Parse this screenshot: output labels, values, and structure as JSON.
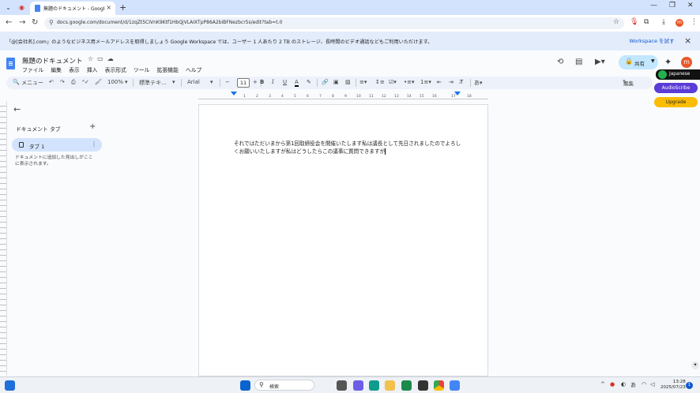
{
  "browser": {
    "tab_title": "無題のドキュメント - Google ドキュ",
    "url": "docs.google.com/document/d/1zqZt5CIVnK9Ktf1HbQjVLAIXTpP86A2biBFNezbcr5s/edit?tab=t.0"
  },
  "banner": {
    "message": "「@[会社名].com」のようなビジネス用メールアドレスを取得しましょう Google Workspace では、ユーザー 1 人あたり 2 TB のストレージ、長時間のビデオ通話などもご利用いただけます。",
    "try_label": "Workspace を試す"
  },
  "doc": {
    "title": "無題のドキュメント",
    "menu": [
      "ファイル",
      "編集",
      "表示",
      "挿入",
      "表示形式",
      "ツール",
      "拡張機能",
      "ヘルプ"
    ],
    "share_label": "共有",
    "avatar_letter": "m"
  },
  "format_toolbar": {
    "menus_label": "メニュー",
    "zoom": "100%",
    "style": "標準テキ...",
    "font": "Arial",
    "font_size": "11",
    "edit_mode": "編集"
  },
  "extensions": {
    "japanese": "Japanese",
    "audioscribe": "AudioScribe",
    "upgrade": "Upgrade"
  },
  "ruler_ticks": [
    "1",
    "2",
    "3",
    "4",
    "5",
    "6",
    "7",
    "8",
    "9",
    "10",
    "11",
    "12",
    "13",
    "14",
    "15",
    "16",
    "17",
    "18"
  ],
  "sidebar": {
    "heading": "ドキュメント タブ",
    "tab_label": "タブ 1",
    "hint": "ドキュメントに追加した見出しがここに表示されます。"
  },
  "body": {
    "text": "それではただいまから第1回取締役会を開催いたします私は議長として先日されましたのでよろしくお願いいたしますが私はどうしたらこの議事に質問できますが"
  },
  "taskbar": {
    "search_label": "検索",
    "time": "13:28",
    "date": "2025/07/23",
    "notifications": "1"
  },
  "colors": {
    "accent": "#0b57d0",
    "share_bg": "#c2e7ff",
    "banner_bg": "#e3ecfb",
    "audioscribe": "#5b3cd6",
    "upgrade": "#fbbc04"
  }
}
